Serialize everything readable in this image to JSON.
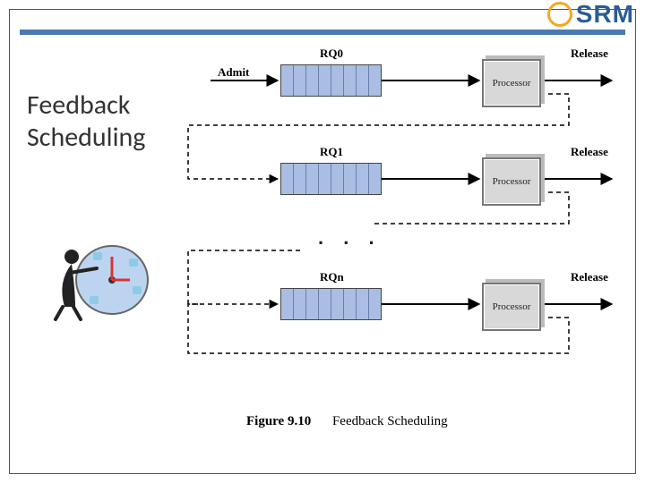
{
  "logo_text": "SRM",
  "title_line1": "Feedback",
  "title_line2": "Scheduling",
  "admit_label": "Admit",
  "release_label": "Release",
  "processor_label": "Processor",
  "queues": [
    "RQ0",
    "RQ1",
    "RQn"
  ],
  "ellipsis": ". . .",
  "caption_fig": "Figure 9.10",
  "caption_text": "Feedback Scheduling",
  "chart_data": {
    "type": "diagram",
    "title": "Feedback Scheduling",
    "description": "Multilevel feedback queue scheduling: processes are admitted into RQ0; each ready queue feeds a Processor which either releases the process or demotes it (via dashed feedback path) to the next lower-priority ready queue.",
    "levels": [
      {
        "queue": "RQ0",
        "input": "Admit",
        "processor": "Processor",
        "output": "Release",
        "feedback_to": "RQ1"
      },
      {
        "queue": "RQ1",
        "input": "from RQ0 feedback",
        "processor": "Processor",
        "output": "Release",
        "feedback_to": "next (…)"
      },
      {
        "queue": "RQn",
        "input": "from RQ(n-1) feedback",
        "processor": "Processor",
        "output": "Release",
        "feedback_to": "RQn (self)"
      }
    ]
  }
}
